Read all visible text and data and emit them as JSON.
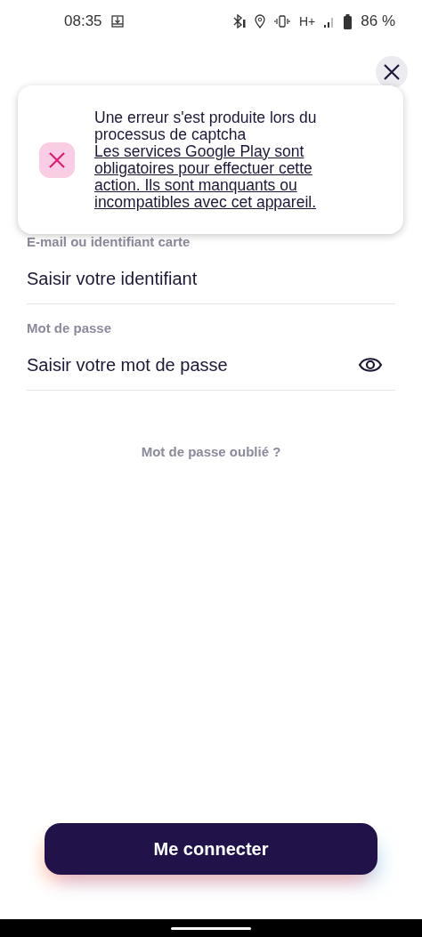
{
  "status_bar": {
    "time": "08:35",
    "battery": "86 %",
    "network": "H+"
  },
  "toast": {
    "kind": "error",
    "title": "Une erreur s'est produite lors du processus de captcha",
    "link": "Les services Google Play sont obligatoires pour effectuer cette action. Ils sont manquants ou incompatibles avec cet appareil."
  },
  "fields": [
    {
      "label": "E-mail ou identifiant carte",
      "placeholder": "Saisir votre identifiant",
      "kind": "text"
    },
    {
      "label": "Mot de passe",
      "placeholder": "Saisir votre mot de passe",
      "kind": "password"
    }
  ],
  "forgot_link": "Mot de passe oublié ?",
  "submit_button": "Me connecter"
}
